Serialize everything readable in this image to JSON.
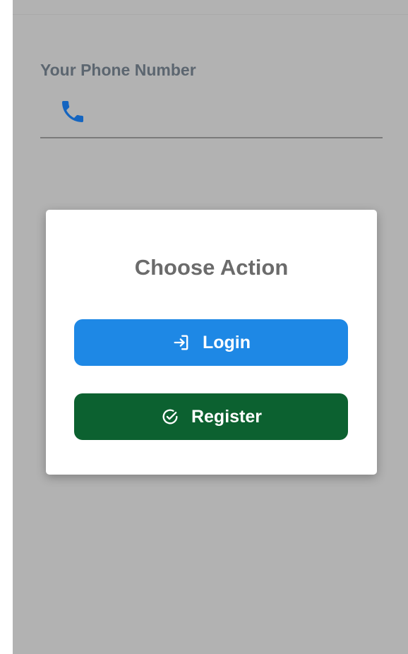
{
  "phone": {
    "label": "Your Phone Number",
    "value": "",
    "icon": "phone-icon",
    "icon_color": "#1565c0"
  },
  "dialog": {
    "title": "Choose Action",
    "login_label": "Login",
    "login_icon": "login-icon",
    "login_color": "#1e88e5",
    "register_label": "Register",
    "register_icon": "check-circle-icon",
    "register_color": "#0c6130"
  },
  "colors": {
    "overlay": "#b2b2b2",
    "dialog_bg": "#ffffff"
  }
}
